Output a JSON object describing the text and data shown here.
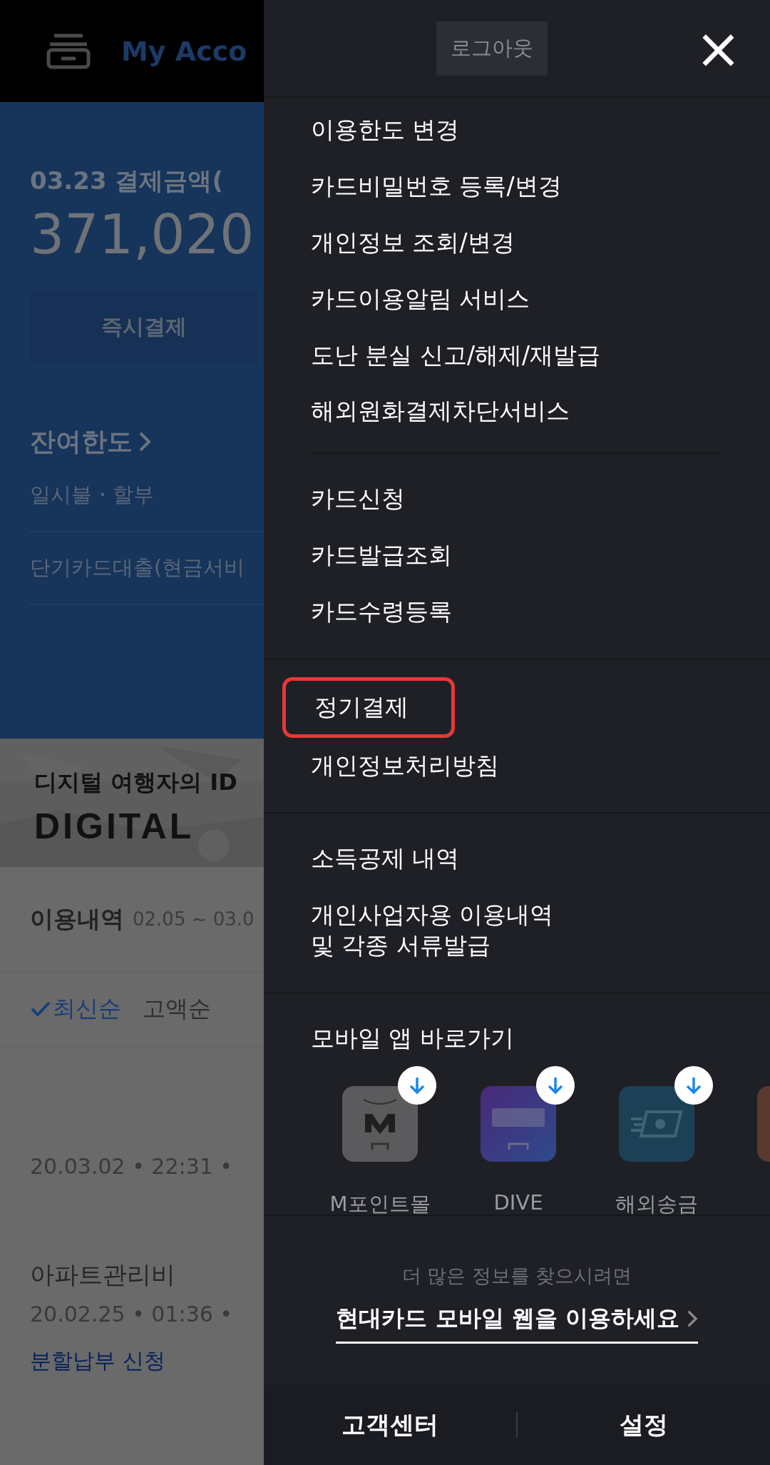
{
  "page": {
    "header": {
      "title": "My Acco"
    },
    "billing": {
      "label": "03.23 결제금액(",
      "amount": "371,020",
      "pay_button": "즉시결제"
    },
    "limit": {
      "title": "잔여한도",
      "rows": [
        "일시불・할부",
        "단기카드대출(현금서비"
      ]
    },
    "banner": {
      "kind": "picture",
      "line_1": "디지털 여행자의 ID",
      "line_2": "DIGITAL"
    },
    "history": {
      "title": "이용내역",
      "period": "02.05 ~ 03.0",
      "sort": [
        {
          "label": "최신순",
          "selected": true
        },
        {
          "label": "고액순",
          "selected": false
        }
      ],
      "rows": [
        {
          "date": "20.03.02",
          "time": "22:31",
          "sep": "•"
        },
        {
          "merchant": "아파트관리비",
          "date": "20.02.25",
          "time": "01:36",
          "sep": "•",
          "action": "분할납부 신청"
        }
      ]
    }
  },
  "drawer": {
    "logout": "로그아웃",
    "close": "×",
    "groups": [
      [
        {
          "label": "이용한도 변경",
          "highlighted": false
        },
        {
          "label": "카드비밀번호 등록/변경",
          "highlighted": false
        },
        {
          "label": "개인정보 조회/변경",
          "highlighted": false
        },
        {
          "label": "카드이용알림 서비스",
          "highlighted": false
        },
        {
          "label": "도난 분실 신고/해제/재발급",
          "highlighted": false
        },
        {
          "label": "해외원화결제차단서비스",
          "highlighted": false
        }
      ],
      [
        {
          "label": "카드신청",
          "highlighted": false
        },
        {
          "label": "카드발급조회",
          "highlighted": false
        },
        {
          "label": "카드수령등록",
          "highlighted": false
        }
      ],
      [
        {
          "label": "정기결제",
          "highlighted": true
        },
        {
          "label": "개인정보처리방침",
          "highlighted": false
        }
      ],
      [
        {
          "label": "소득공제 내역",
          "highlighted": false
        },
        {
          "label": "개인사업자용 이용내역\n및 각종 서류발급",
          "highlighted": false
        }
      ]
    ],
    "apps": {
      "title": "모바일 앱 바로가기",
      "items": [
        {
          "kind": "mpoint",
          "name": "M포인트몰"
        },
        {
          "kind": "dive",
          "name": "DIVE"
        },
        {
          "kind": "remit",
          "name": "해외송금"
        },
        {
          "kind": "cut"
        }
      ]
    },
    "more": {
      "hint": "더 많은 정보를 찾으시려면",
      "link": "현대카드 모바일 웹을 이용하세요"
    },
    "footer": [
      "고객센터",
      "설정"
    ]
  }
}
